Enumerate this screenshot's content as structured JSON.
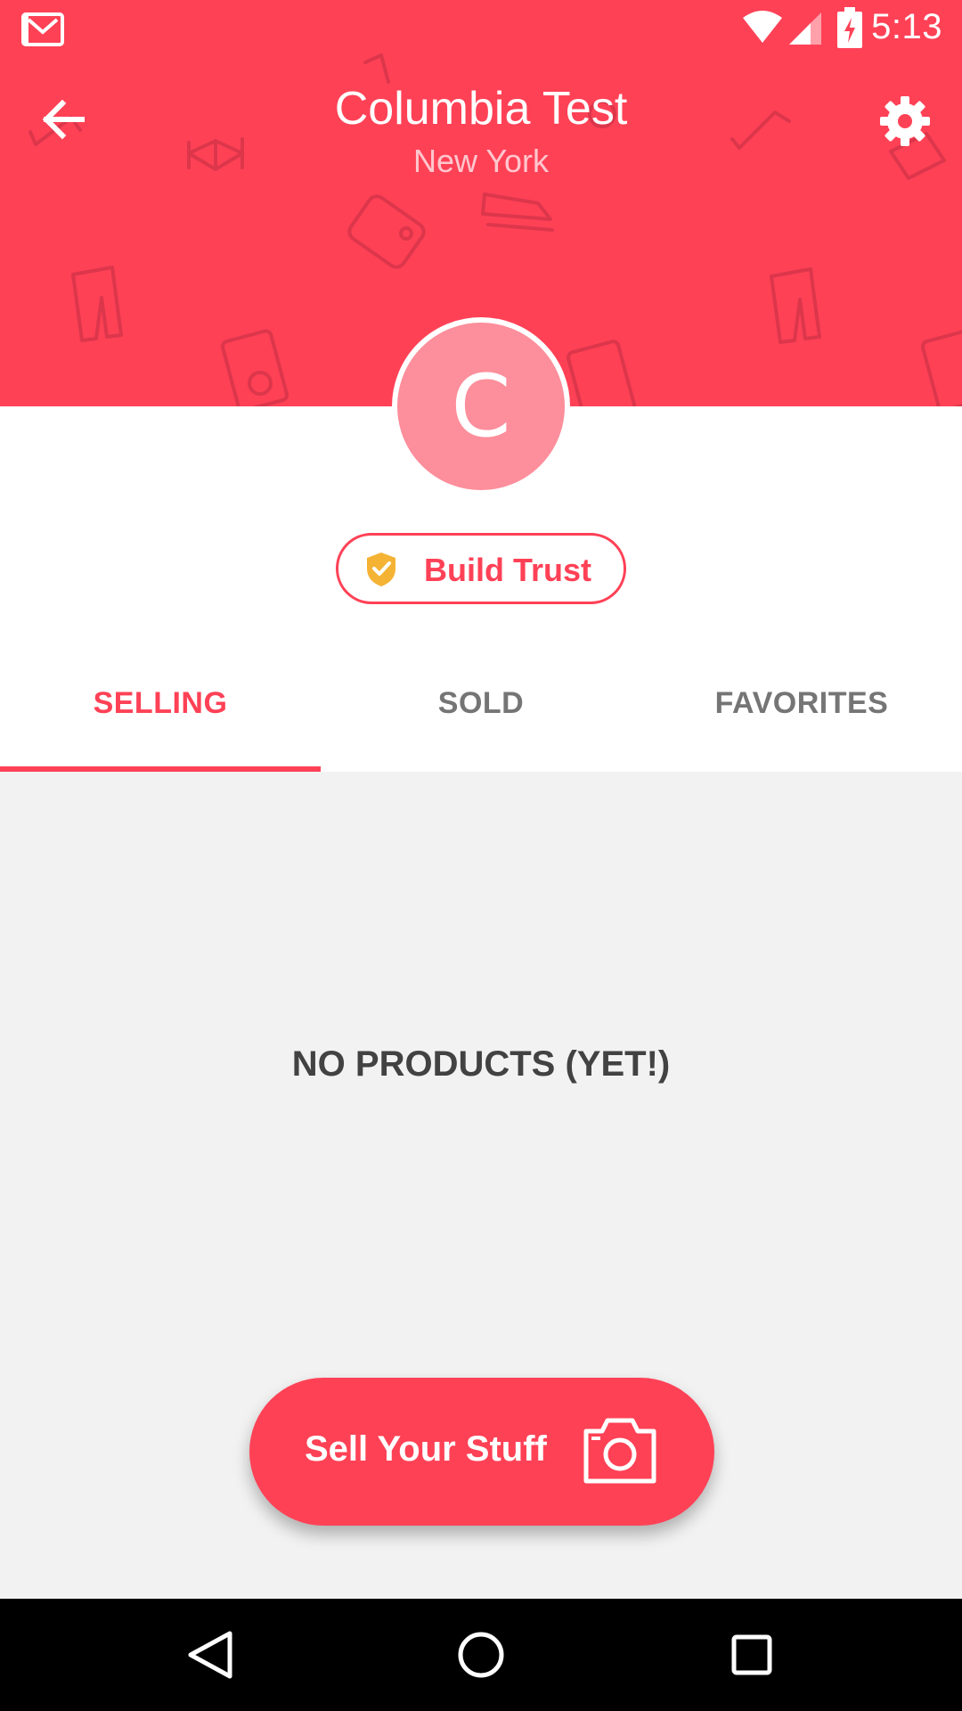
{
  "status_bar": {
    "time": "5:13"
  },
  "header": {
    "title": "Columbia Test",
    "subtitle": "New York"
  },
  "profile": {
    "avatar_initial": "C",
    "build_trust_label": "Build Trust"
  },
  "tabs": [
    {
      "label": "SELLING",
      "active": true
    },
    {
      "label": "SOLD",
      "active": false
    },
    {
      "label": "FAVORITES",
      "active": false
    }
  ],
  "content": {
    "empty_message": "NO PRODUCTS (YET!)"
  },
  "fab": {
    "label": "Sell Your Stuff"
  },
  "colors": {
    "brand": "#ff4156",
    "avatar_bg": "#fd8e9b",
    "content_bg": "#f2f2f2",
    "trust_shield": "#f5b335"
  },
  "icons": {
    "status_left": "gmail-icon",
    "back": "arrow-left-icon",
    "settings": "gear-icon",
    "shield": "shield-check-icon",
    "camera": "camera-icon",
    "nav": [
      "triangle-back-icon",
      "circle-home-icon",
      "square-recents-icon"
    ]
  }
}
